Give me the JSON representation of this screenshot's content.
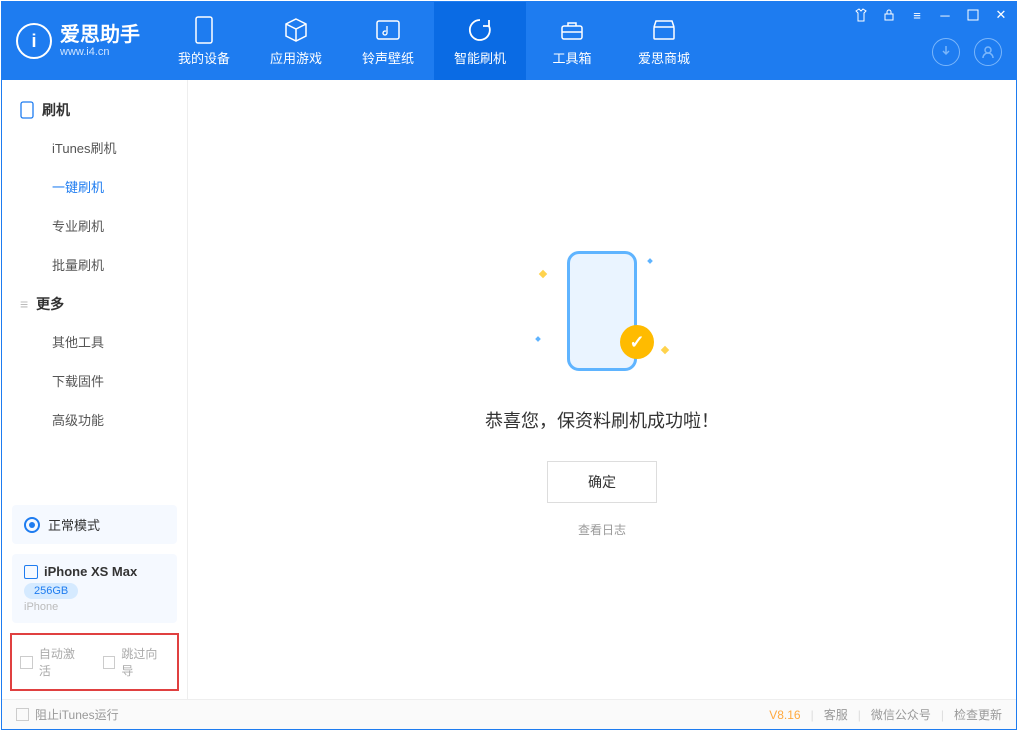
{
  "app": {
    "name": "爱思助手",
    "sub": "www.i4.cn"
  },
  "tabs": {
    "device": "我的设备",
    "apps": "应用游戏",
    "ring": "铃声壁纸",
    "flash": "智能刷机",
    "toolbox": "工具箱",
    "store": "爱思商城"
  },
  "sidebar": {
    "section_flash": "刷机",
    "items_flash": {
      "itunes": "iTunes刷机",
      "oneclick": "一键刷机",
      "pro": "专业刷机",
      "batch": "批量刷机"
    },
    "section_more": "更多",
    "items_more": {
      "other": "其他工具",
      "firmware": "下载固件",
      "advanced": "高级功能"
    },
    "status_label": "正常模式",
    "device_name": "iPhone XS Max",
    "device_capacity": "256GB",
    "device_type": "iPhone",
    "chk_activate": "自动激活",
    "chk_skipguide": "跳过向导"
  },
  "main": {
    "success_msg": "恭喜您，保资料刷机成功啦！",
    "ok_label": "确定",
    "log_label": "查看日志"
  },
  "footer": {
    "stop_itunes": "阻止iTunes运行",
    "version": "V8.16",
    "kefu": "客服",
    "wechat": "微信公众号",
    "update": "检查更新"
  }
}
